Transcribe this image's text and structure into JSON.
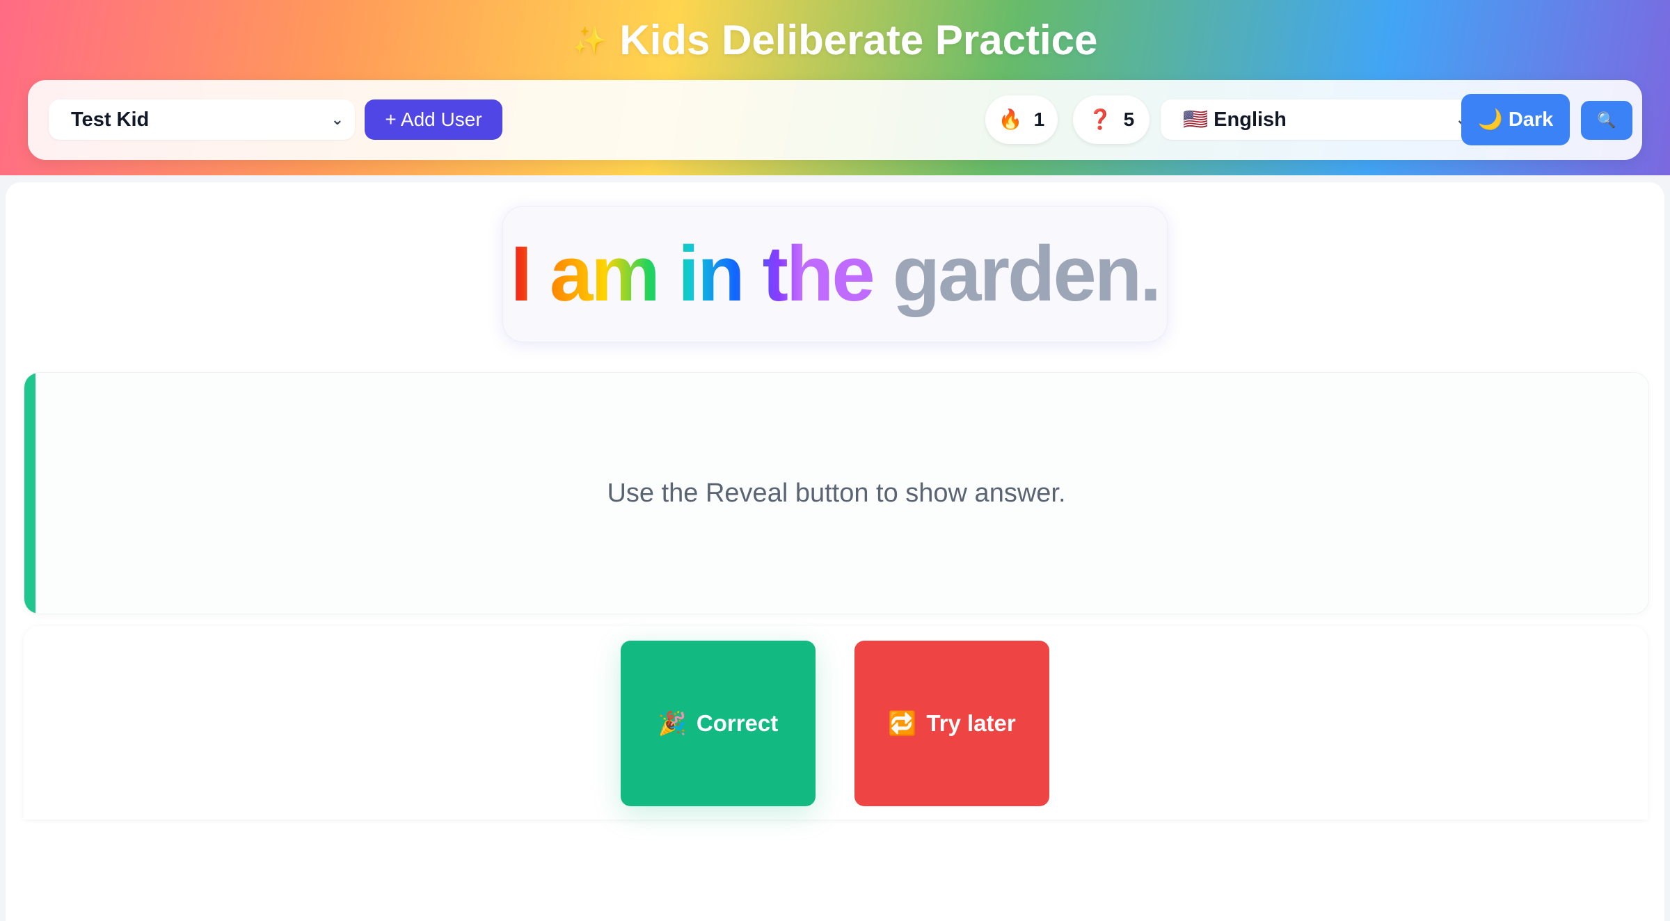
{
  "app": {
    "title": "Kids Deliberate Practice",
    "title_icon": "sparkles-icon"
  },
  "toolbar": {
    "user_select": {
      "value": "Test Kid"
    },
    "add_user_label": "+ Add User",
    "streak": {
      "icon": "fire-icon",
      "value": "1"
    },
    "count": {
      "icon": "diamond-question-icon",
      "value": "5"
    },
    "language_select": {
      "flag": "us-flag-icon",
      "value": "English"
    },
    "dark_label": "Dark",
    "dark_icon": "moon-icon",
    "search_icon": "magnifier-icon"
  },
  "practice": {
    "sentence_highlighted": "I am in the",
    "sentence_rest": "garden.",
    "hint": "Use the Reveal button to show answer."
  },
  "actions": {
    "correct_label": "Correct",
    "correct_icon": "party-popper-icon",
    "try_later_label": "Try later",
    "try_later_icon": "repeat-icon"
  },
  "colors": {
    "accent_indigo": "#4f46e5",
    "accent_blue": "#3b82f6",
    "correct_green": "#12b981",
    "try_later_red": "#ef4444",
    "panel_accent_green": "#1fc78e"
  }
}
